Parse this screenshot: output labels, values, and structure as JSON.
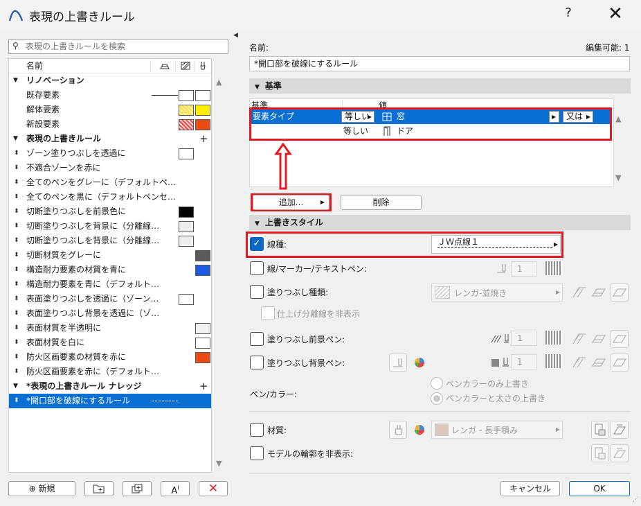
{
  "window": {
    "title": "表現の上書きルール",
    "help": "?",
    "close": "✕"
  },
  "search": {
    "placeholder": "表現の上書きルールを検索"
  },
  "list": {
    "header": "名前",
    "groups": [
      {
        "label": "リノベーション",
        "items": [
          "既存要素",
          "解体要素",
          "新設要素"
        ]
      },
      {
        "label": "表現の上書きルール",
        "items": [
          "ゾーン塗りつぶしを透過に",
          "不適合ゾーンを赤に",
          "全てのペンをグレーに（デフォルトペ…",
          "全てのペンを黒に（デフォルトペンセ…",
          "切断塗りつぶしを前景色に",
          "切断塗りつぶしを背景に（分離線…",
          "切断塗りつぶしを背景に（分離線…",
          "切断材質をグレーに",
          "構造耐力要素の材質を青に",
          "構造耐力要素を青に（デフォルト…",
          "表面塗りつぶしを透過に（ゾーン…",
          "表面塗りつぶし背景を透過に（ゾ…",
          "表面材質を半透明に",
          "表面材質を白に",
          "防火区画要素の材質を赤に",
          "防火区画要素を赤に（デフォルト…"
        ]
      },
      {
        "label": "*表現の上書きルール ナレッジ",
        "items": [
          "*開口部を破線にするルール"
        ]
      }
    ]
  },
  "buttons": {
    "new": "新規",
    "ok": "OK",
    "cancel": "キャンセル"
  },
  "right": {
    "name_label": "名前:",
    "editable": "編集可能: 1",
    "name_value": "*開口部を破線にするルール",
    "criteria_section": "基準",
    "crit_col1": "基準",
    "crit_col2": "値",
    "crit_rows": [
      {
        "criterion": "要素タイプ",
        "op": "等しい",
        "value": "窓",
        "logic": "又は"
      },
      {
        "criterion": "",
        "op": "等しい",
        "value": "ドア",
        "logic": ""
      }
    ],
    "add_button": "追加...",
    "delete_button": "削除",
    "style_section": "上書きスタイル",
    "linetype_label": "線種:",
    "linetype_value": "ＪＷ点線１",
    "line_pen_label": "線/マーカー/テキストペン:",
    "line_pen_value": "1",
    "fill_type_label": "塗りつぶし種類:",
    "fill_type_value": "レンガ-並焼き",
    "hide_sep_label": "仕上げ分離線を非表示",
    "fill_fg_label": "塗りつぶし前景ペン:",
    "fill_fg_value": "1",
    "fill_bg_label": "塗りつぶし背景ペン:",
    "fill_bg_value": "1",
    "pen_color_label": "ペン/カラー:",
    "pen_color_opt1": "ペンカラーのみ上書き",
    "pen_color_opt2": "ペンカラーと太さの上書き",
    "material_label": "材質:",
    "material_value": "レンガ - 長手積み",
    "hide_contour_label": "モデルの輪郭を非表示:"
  }
}
